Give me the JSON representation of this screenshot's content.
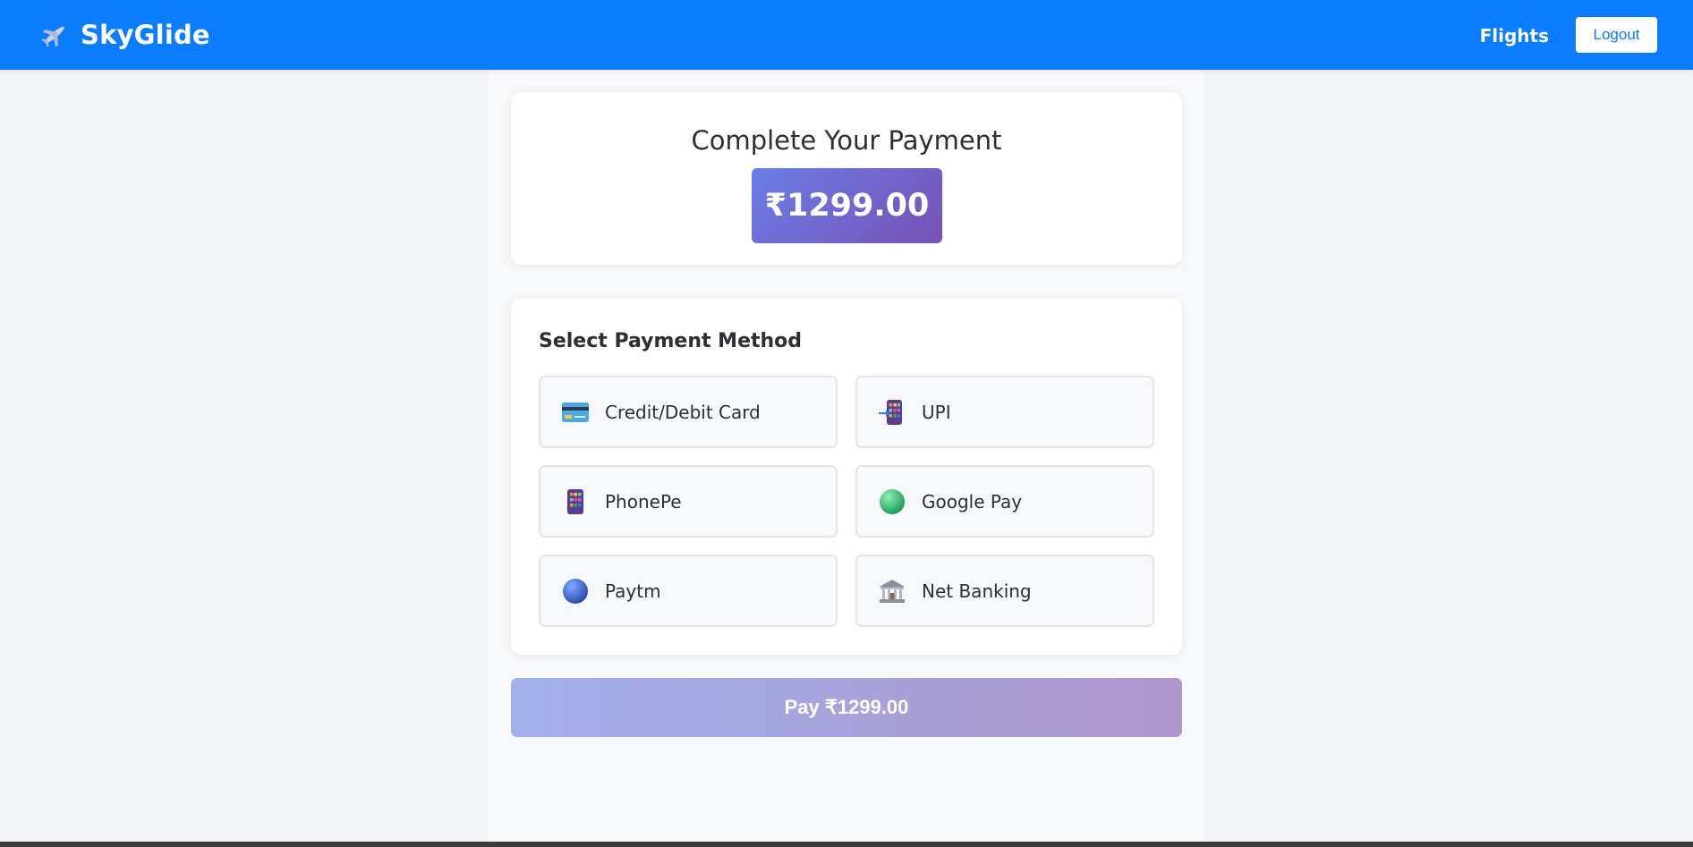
{
  "navbar": {
    "brand_icon": "airplane-icon",
    "brand_name": "SkyGlide",
    "flights_link": "Flights",
    "logout_label": "Logout",
    "bg_color": "#0a7cff"
  },
  "summary": {
    "title": "Complete Your Payment",
    "amount": "₹1299.00"
  },
  "payment_methods": {
    "title": "Select Payment Method",
    "items": [
      {
        "label": "Credit/Debit Card",
        "icon": "credit-card-icon"
      },
      {
        "label": "UPI",
        "icon": "mobile-transfer-icon"
      },
      {
        "label": "PhonePe",
        "icon": "phone-grid-icon"
      },
      {
        "label": "Google Pay",
        "icon": "green-circle-icon"
      },
      {
        "label": "Paytm",
        "icon": "blue-circle-icon"
      },
      {
        "label": "Net Banking",
        "icon": "bank-icon"
      }
    ]
  },
  "pay_button": {
    "label": "Pay ₹1299.00"
  }
}
